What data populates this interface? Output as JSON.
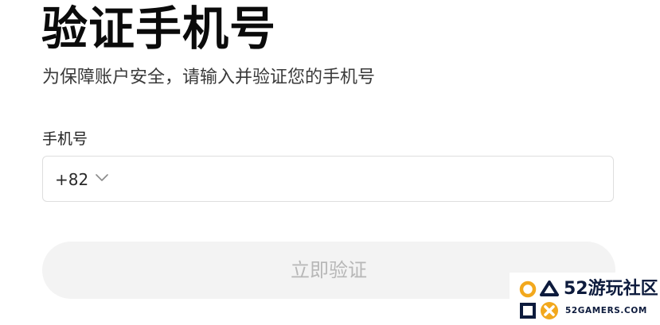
{
  "header": {
    "title": "验证手机号",
    "subtitle": "为保障账户安全，请输入并验证您的手机号"
  },
  "form": {
    "phone_label": "手机号",
    "country_code": "+82",
    "country_code_icon": "chevron-down-icon",
    "phone_value": "",
    "phone_placeholder": ""
  },
  "actions": {
    "verify_label": "立即验证"
  },
  "watermark": {
    "title": "52游玩社区",
    "subtitle": "52GAMERS.COM",
    "icon": "gamepad-symbols-logo"
  },
  "colors": {
    "title": "#0b0b0b",
    "button_bg": "#f3f3f3",
    "button_text": "#b7b7b7",
    "watermark_orange": "#f2a81d",
    "watermark_navy": "#0d1b3d"
  }
}
